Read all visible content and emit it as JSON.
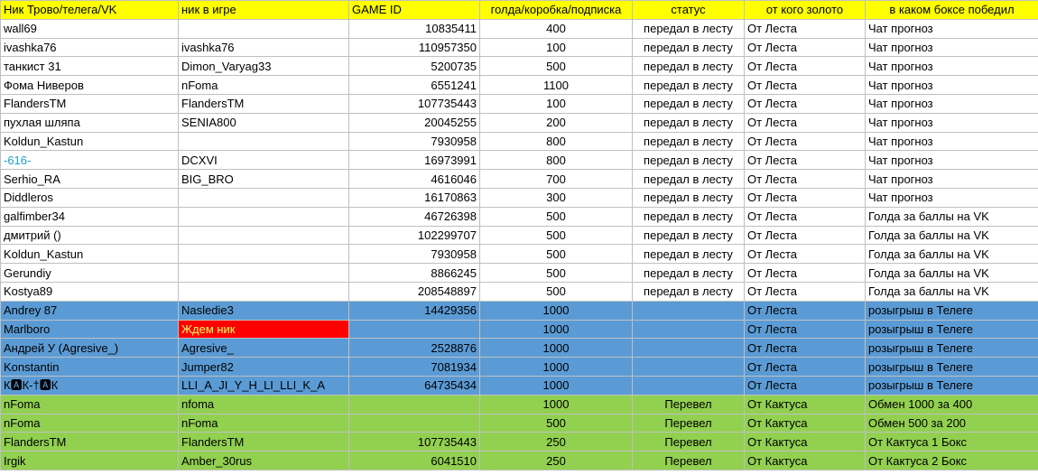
{
  "headers": [
    "Ник Трово/телега/VK",
    "ник в игре",
    "GAME ID",
    "голда/коробка/подписка",
    "статус",
    "от кого золото",
    "в каком боксе победил"
  ],
  "rows": [
    {
      "style": "white",
      "nick": "wall69",
      "game_nick": "",
      "game_id": "10835411",
      "amount": "400",
      "status": "передал в лесту",
      "from": "От Леста",
      "box": "Чат прогноз"
    },
    {
      "style": "white",
      "nick": "ivashka76",
      "game_nick": "ivashka76",
      "game_id": "110957350",
      "amount": "100",
      "status": "передал в лесту",
      "from": "От Леста",
      "box": "Чат прогноз"
    },
    {
      "style": "white",
      "nick": "танкист 31",
      "game_nick": "Dimon_Varyag33",
      "game_id": "5200735",
      "amount": "500",
      "status": "передал в лесту",
      "from": "От Леста",
      "box": "Чат прогноз"
    },
    {
      "style": "white",
      "nick": "Фома Ниверов",
      "game_nick": "nFoma",
      "game_id": "6551241",
      "amount": "1100",
      "status": "передал в лесту",
      "from": "От Леста",
      "box": "Чат прогноз"
    },
    {
      "style": "white",
      "nick": "FlandersTM",
      "game_nick": "FlandersTM",
      "game_id": "107735443",
      "amount": "100",
      "status": "передал в лесту",
      "from": "От Леста",
      "box": "Чат прогноз"
    },
    {
      "style": "white",
      "nick": "пухлая шляпа",
      "game_nick": "SENIA800",
      "game_id": "20045255",
      "amount": "200",
      "status": "передал в лесту",
      "from": "От Леста",
      "box": "Чат прогноз"
    },
    {
      "style": "white",
      "nick": "Koldun_Kastun",
      "game_nick": "",
      "game_id": "7930958",
      "amount": "800",
      "status": "передал в лесту",
      "from": "От Леста",
      "box": "Чат прогноз"
    },
    {
      "style": "white",
      "nick": "-616-",
      "nick_link": true,
      "game_nick": "DCXVI",
      "game_id": "16973991",
      "amount": "800",
      "status": "передал в лесту",
      "from": "От Леста",
      "box": "Чат прогноз"
    },
    {
      "style": "white",
      "nick": "Serhio_RA",
      "game_nick": "BIG_BRO",
      "game_id": "4616046",
      "amount": "700",
      "status": "передал в лесту",
      "from": "От Леста",
      "box": "Чат прогноз"
    },
    {
      "style": "white",
      "nick": "Diddleros",
      "game_nick": "",
      "game_id": "16170863",
      "amount": "300",
      "status": "передал в лесту",
      "from": "От Леста",
      "box": "Чат прогноз"
    },
    {
      "style": "white",
      "nick": "galfimber34",
      "game_nick": "",
      "game_id": "46726398",
      "amount": "500",
      "status": "передал в лесту",
      "from": "От Леста",
      "box": "Голда за баллы на VK"
    },
    {
      "style": "white",
      "nick": "дмитрий ()",
      "game_nick": "",
      "game_id": "102299707",
      "amount": "500",
      "status": "передал в лесту",
      "from": "От Леста",
      "box": "Голда за баллы на VK"
    },
    {
      "style": "white",
      "nick": "Koldun_Kastun",
      "game_nick": "",
      "game_id": "7930958",
      "amount": "500",
      "status": "передал в лесту",
      "from": "От Леста",
      "box": "Голда за баллы на VK"
    },
    {
      "style": "white",
      "nick": "Gerundiy",
      "game_nick": "",
      "game_id": "8866245",
      "amount": "500",
      "status": "передал в лесту",
      "from": "От Леста",
      "box": "Голда за баллы на VK"
    },
    {
      "style": "white",
      "nick": "Kostya89",
      "game_nick": "",
      "game_id": "208548897",
      "amount": "500",
      "status": "передал в лесту",
      "from": "От Леста",
      "box": "Голда за баллы на VK"
    },
    {
      "style": "blue",
      "nick": "Andrey 87",
      "game_nick": "Nasledie3",
      "game_id": "14429356",
      "amount": "1000",
      "status": "",
      "from": "От Леста",
      "box": "розыгрыш в Телеге"
    },
    {
      "style": "blue",
      "nick": "Marlboro",
      "game_nick": "Ждем ник",
      "game_nick_red": true,
      "game_id": "",
      "amount": "1000",
      "status": "",
      "from": "От Леста",
      "box": "розыгрыш в Телеге"
    },
    {
      "style": "blue",
      "nick": "Андрей У (Agresive_)",
      "game_nick": "Agresive_",
      "game_id": "2528876",
      "amount": "1000",
      "status": "",
      "from": "От Леста",
      "box": "розыгрыш в Телеге"
    },
    {
      "style": "blue",
      "nick": "Konstantin",
      "game_nick": "Jumper82",
      "game_id": "7081934",
      "amount": "1000",
      "status": "",
      "from": "От Леста",
      "box": "розыгрыш в Телеге"
    },
    {
      "style": "blue",
      "nick": "К🅰К-†🅰К",
      "game_nick": "LLI_A_JI_Y_H_LI_LLI_K_A",
      "game_id": "64735434",
      "amount": "1000",
      "status": "",
      "from": "От Леста",
      "box": "розыгрыш в Телеге"
    },
    {
      "style": "green",
      "nick": "nFoma",
      "game_nick": "nfoma",
      "game_id": "",
      "amount": "1000",
      "status": "Перевел",
      "from": "От Кактуса",
      "box": "Обмен 1000 за 400"
    },
    {
      "style": "green",
      "nick": "nFoma",
      "game_nick": "nFoma",
      "game_id": "",
      "amount": "500",
      "status": "Перевел",
      "from": "От Кактуса",
      "box": "Обмен 500 за 200"
    },
    {
      "style": "green",
      "nick": "FlandersTM",
      "game_nick": "FlandersTM",
      "game_id": "107735443",
      "amount": "250",
      "status": "Перевел",
      "from": "От Кактуса",
      "box": "От Кактуса 1 Бокс"
    },
    {
      "style": "green",
      "nick": "Irgik",
      "game_nick": "Amber_30rus",
      "game_id": "6041510",
      "amount": "250",
      "status": "Перевел",
      "from": "От Кактуса",
      "box": "От Кактуса 2 Бокс"
    }
  ]
}
